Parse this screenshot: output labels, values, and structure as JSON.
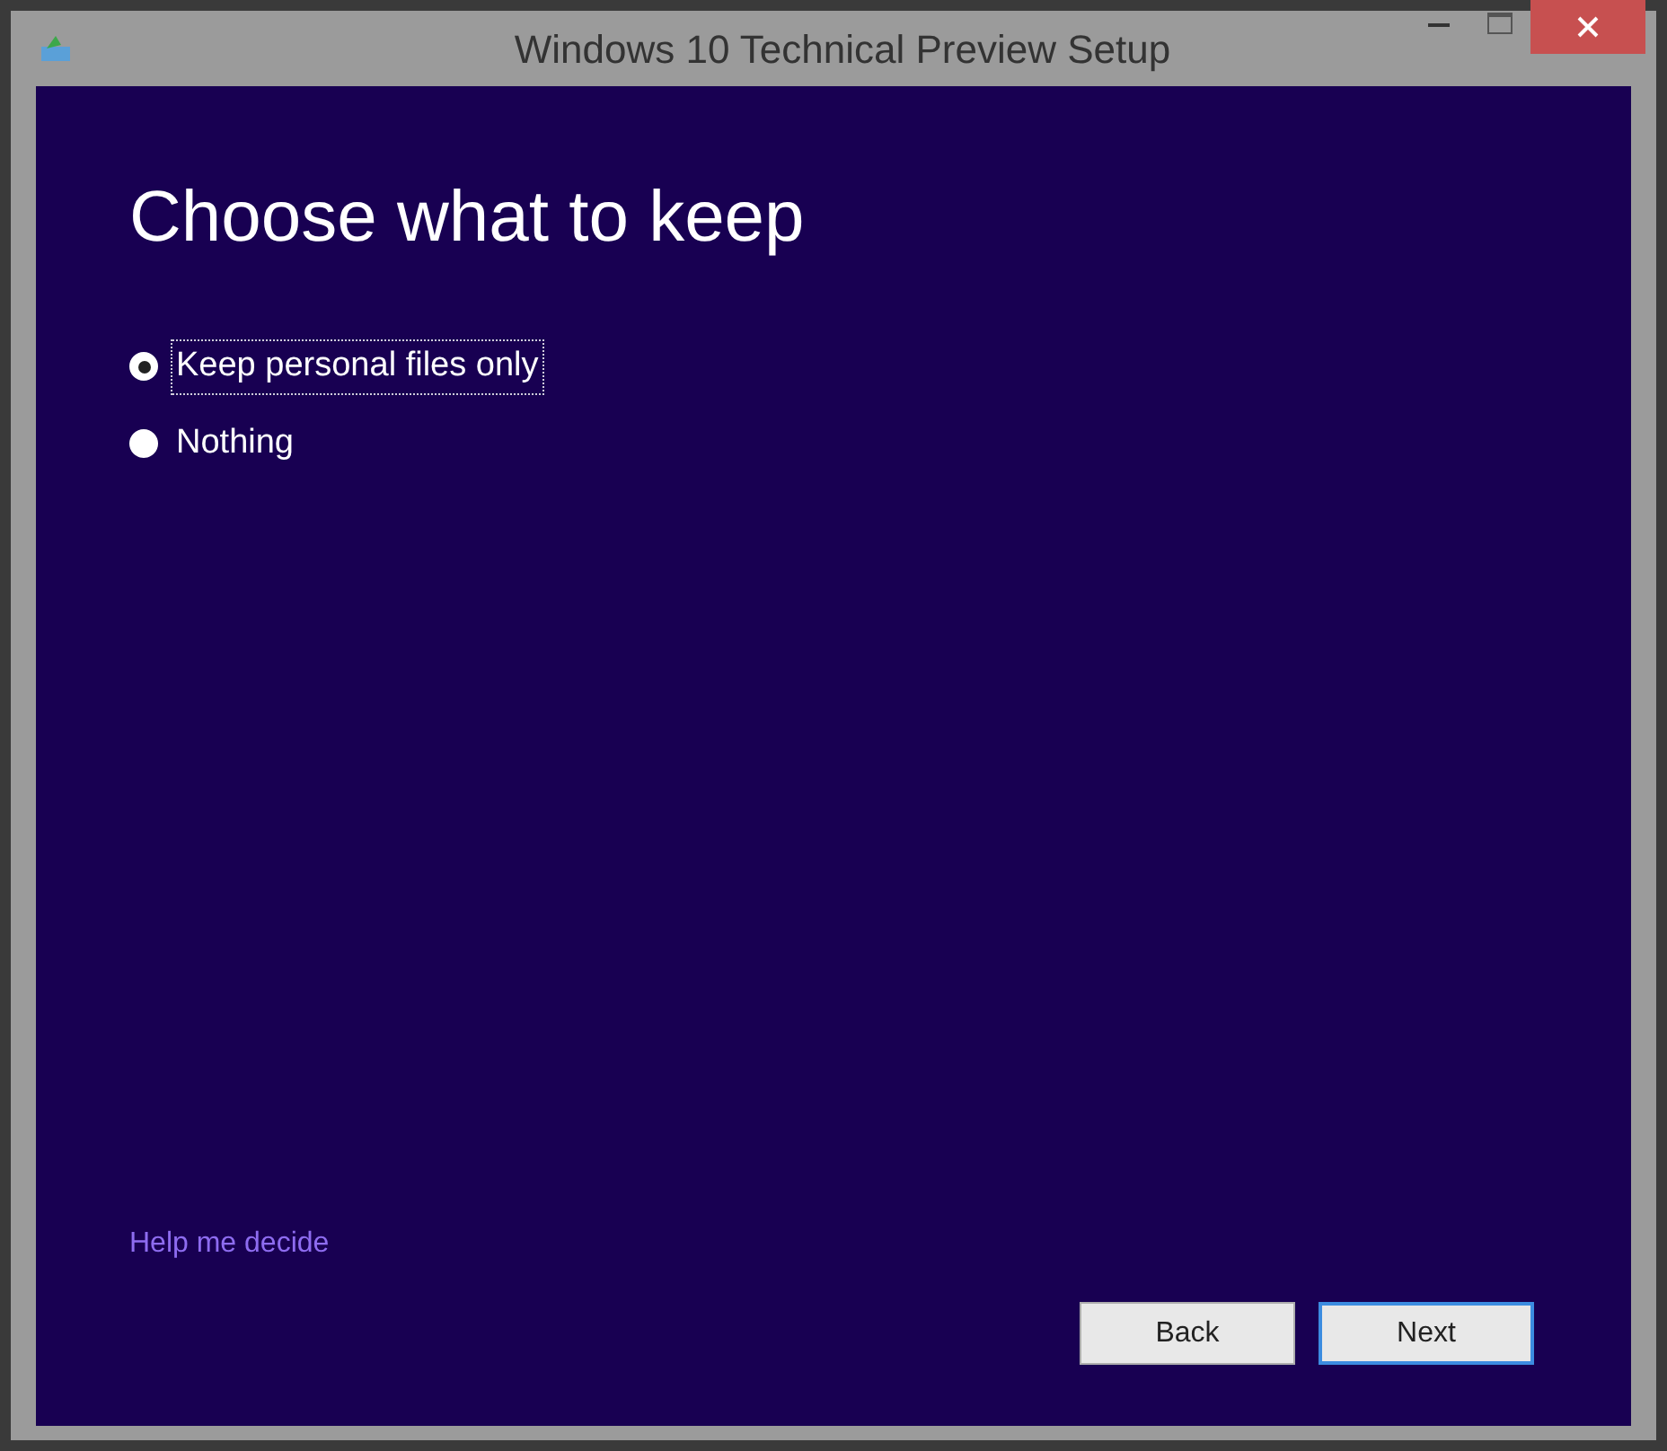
{
  "window": {
    "title": "Windows 10 Technical Preview Setup"
  },
  "heading": "Choose what to keep",
  "options": [
    {
      "label": "Keep personal files only",
      "selected": true
    },
    {
      "label": "Nothing",
      "selected": false
    }
  ],
  "help_link": "Help me decide",
  "buttons": [
    {
      "label": "Back",
      "default": false
    },
    {
      "label": "Next",
      "default": true
    }
  ]
}
